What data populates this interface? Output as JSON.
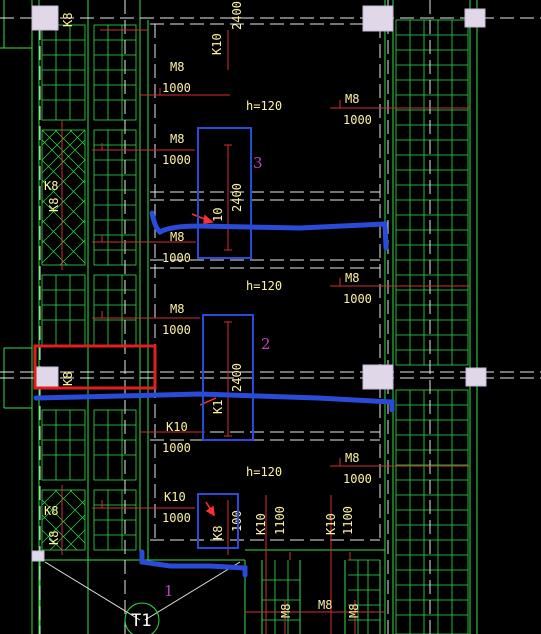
{
  "drawing": {
    "colors": {
      "background": "#000000",
      "grid_line": "#2ee04a",
      "dash_line": "#e8e8e8",
      "rebar": "#d03030",
      "text": "#fff3a0",
      "marker": "#c040c0",
      "blue_markup": "#2a4bd8",
      "red_markup": "#e02020",
      "column": "#e0d8e8"
    },
    "slab_labels": {
      "h1": "h=120",
      "h2": "h=120",
      "h3": "h=120"
    },
    "bars": [
      {
        "id": "m8_top",
        "main": "M8",
        "sub": "1000"
      },
      {
        "id": "m8_left1",
        "main": "M8",
        "sub": "1000"
      },
      {
        "id": "m8_left2",
        "main": "M8",
        "sub": "1000"
      },
      {
        "id": "m8_right1",
        "main": "M8",
        "sub": "1000"
      },
      {
        "id": "m8_right2",
        "main": "M8",
        "sub": "1000"
      },
      {
        "id": "m8_mid",
        "main": "M8",
        "sub": "1000"
      },
      {
        "id": "m8_right3",
        "main": "M8",
        "sub": "1000"
      },
      {
        "id": "k10_a",
        "main": "K10",
        "sub": "1000"
      },
      {
        "id": "k10_b",
        "main": "K10",
        "sub": "1000"
      }
    ],
    "vertical_labels": {
      "k10_top": "K10",
      "top_2400": "2400",
      "k8_col1": "K8",
      "k8_col1b": "K8",
      "k8_tl": "K8",
      "k8_mid": "K8",
      "k8_bottom": "K8",
      "k8_bottom2": "K8",
      "k8_hatch_b": "K8",
      "k10_box3": "10",
      "box3_2400": "2400",
      "box2_2400": "2400",
      "k1_box2": "K1",
      "box1_k8": "K8",
      "box1_100": "100",
      "k10_b1": "K10",
      "b1_1100": "1100",
      "k10_b2": "K10",
      "b2_1100": "1100",
      "m8_b1": "M8",
      "m8_b2": "M8",
      "m8_b3": "M8"
    },
    "markers": {
      "one": "1",
      "two": "2",
      "three": "3",
      "t1": "T1"
    }
  }
}
